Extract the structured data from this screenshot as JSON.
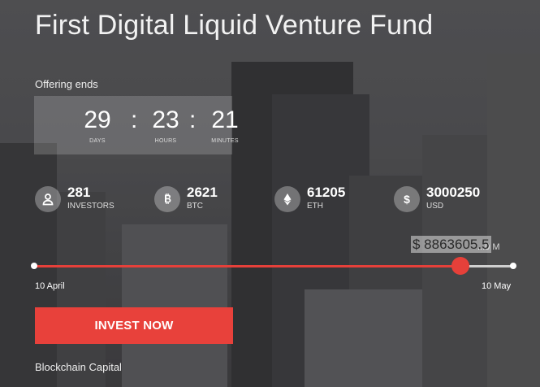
{
  "fund": {
    "title": "First Digital Liquid Venture Fund",
    "offering_label": "Offering ends",
    "sponsor": "Blockchain Capital"
  },
  "countdown": {
    "days": "29",
    "days_label": "DAYS",
    "hours": "23",
    "hours_label": "HOURS",
    "minutes": "21",
    "minutes_label": "MINUTES",
    "separator": ":"
  },
  "stats": [
    {
      "icon": "user-icon",
      "value": "281",
      "label": "INVESTORS"
    },
    {
      "icon": "bitcoin-icon",
      "value": "2621",
      "label": "BTC"
    },
    {
      "icon": "ethereum-icon",
      "value": "61205",
      "label": "ETH"
    },
    {
      "icon": "dollar-icon",
      "value": "3000250",
      "label": "USD"
    }
  ],
  "progress": {
    "raised_label": "$ 8863605.5",
    "target_label": "...0 M",
    "start_date": "10 April",
    "end_date": "10 May",
    "fraction": 0.89
  },
  "actions": {
    "invest_label": "INVEST NOW"
  },
  "colors": {
    "accent": "#e8413b",
    "track": "#d0d0d0"
  }
}
